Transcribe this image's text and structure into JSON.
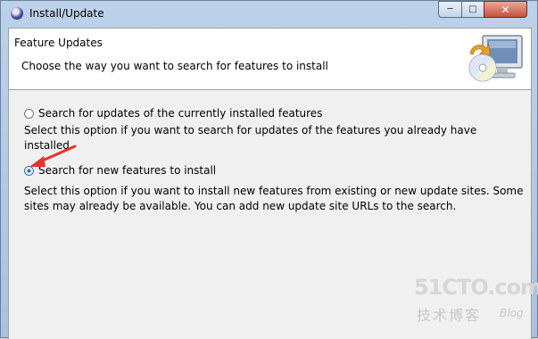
{
  "window": {
    "title": "Install/Update",
    "controls": {
      "minimize": "─",
      "maximize": "□",
      "close": "✕"
    }
  },
  "header": {
    "title": "Feature Updates",
    "description": "Choose the way you want to search for features to install",
    "banner_icon": "computer-cd-icon"
  },
  "options": [
    {
      "label": "Search for updates of the currently installed features",
      "description": "Select this option if you want to search for updates of the features you already have installed.",
      "selected": false
    },
    {
      "label": "Search for new features to install",
      "description": "Select this option if you want to install new features from existing or new update sites. Some sites may already be available. You can add new update site URLs to the search.",
      "selected": true
    }
  ],
  "annotation": {
    "arrow_color": "#e8322e"
  },
  "watermark": {
    "main": "51CTO.com",
    "sub": "技术博客",
    "blog": "Blog"
  },
  "colors": {
    "accent": "#1f6fd0",
    "titlebar": "#bcd1ea"
  }
}
